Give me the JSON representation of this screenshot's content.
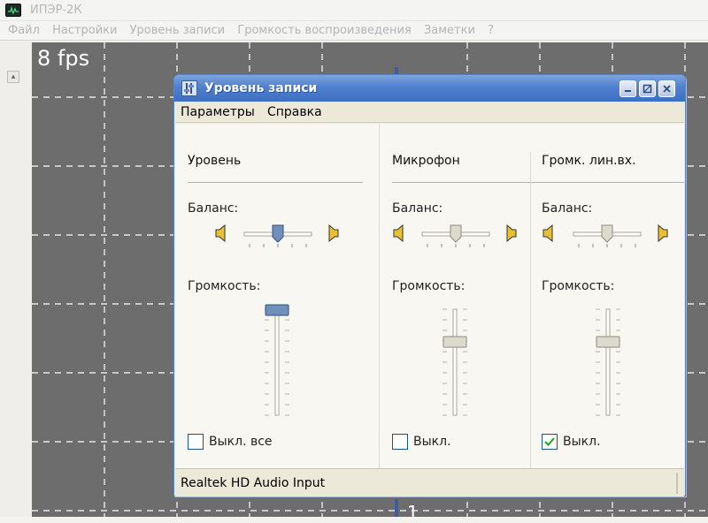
{
  "app": {
    "title": "ИПЭР-2К",
    "menu": [
      "Файл",
      "Настройки",
      "Уровень записи",
      "Громкость воспроизведения",
      "Заметки",
      "?"
    ],
    "fps": "8 fps",
    "scope_bottom_label": "1"
  },
  "dialog": {
    "title": "Уровень записи",
    "menu": [
      "Параметры",
      "Справка"
    ],
    "channels": [
      {
        "name": "Уровень",
        "balance_label": "Баланс:",
        "volume_label": "Громкость:",
        "balance": 0.5,
        "volume": 1.0,
        "mute_label": "Выкл. все",
        "mute_checked": false
      },
      {
        "name": "Микрофон",
        "balance_label": "Баланс:",
        "volume_label": "Громкость:",
        "balance": 0.5,
        "volume": 0.7,
        "mute_label": "Выкл.",
        "mute_checked": false
      },
      {
        "name": "Громк. лин.вх.",
        "balance_label": "Баланс:",
        "volume_label": "Громкость:",
        "balance": 0.5,
        "volume": 0.7,
        "mute_label": "Выкл.",
        "mute_checked": true
      }
    ],
    "status": "Realtek HD Audio Input"
  },
  "colors": {
    "scope_bg": "#6d6d6d",
    "titlebar_blue": "#4f7fcf",
    "checkbox_border": "#1c5180"
  },
  "icons": {
    "app": "oscilloscope-icon",
    "dialog": "mixer-icon",
    "speaker": "speaker-icon"
  }
}
